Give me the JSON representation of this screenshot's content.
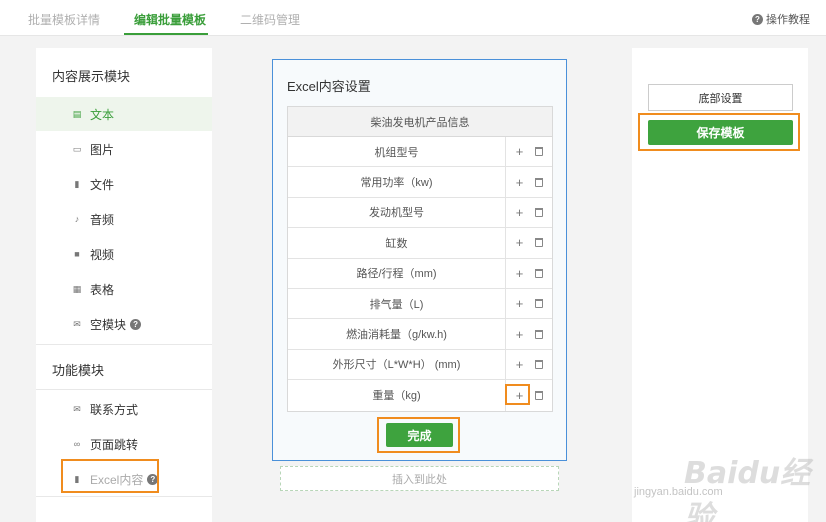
{
  "tabs": [
    {
      "label": "批量模板详情"
    },
    {
      "label": "编辑批量模板"
    },
    {
      "label": "二维码管理"
    }
  ],
  "help_label": "操作教程",
  "left": {
    "section1_title": "内容展示模块",
    "items": [
      {
        "label": "文本",
        "icon": "file-text-icon"
      },
      {
        "label": "图片",
        "icon": "image-icon"
      },
      {
        "label": "文件",
        "icon": "file-icon"
      },
      {
        "label": "音频",
        "icon": "microphone-icon"
      },
      {
        "label": "视频",
        "icon": "video-icon"
      },
      {
        "label": "表格",
        "icon": "table-icon"
      },
      {
        "label": "空模块",
        "icon": "envelope-icon"
      }
    ],
    "section2_title": "功能模块",
    "func_items": [
      {
        "label": "联系方式",
        "icon": "envelope-icon"
      },
      {
        "label": "页面跳转",
        "icon": "link-icon"
      },
      {
        "label": "Excel内容",
        "icon": "file-icon"
      }
    ]
  },
  "card": {
    "title": "Excel内容设置",
    "table_header": "柴油发电机产品信息",
    "rows": [
      {
        "label": "机组型号"
      },
      {
        "label": "常用功率（kw)"
      },
      {
        "label": "发动机型号"
      },
      {
        "label": "缸数"
      },
      {
        "label": "路径/行程（mm)"
      },
      {
        "label": "排气量（L)"
      },
      {
        "label": "燃油消耗量（g/kw.h)"
      },
      {
        "label": "外形尺寸（L*W*H） (mm)"
      },
      {
        "label": "重量（kg)"
      }
    ],
    "done_label": "完成",
    "insert_label": "插入到此处"
  },
  "right": {
    "bottom_settings_label": "底部设置",
    "save_label": "保存模板"
  },
  "watermark": {
    "text": "Baidu经验",
    "url": "jingyan.baidu.com"
  },
  "colors": {
    "accent": "#3ea33e",
    "highlight": "#f08c1e",
    "card_border": "#4a90d9"
  }
}
